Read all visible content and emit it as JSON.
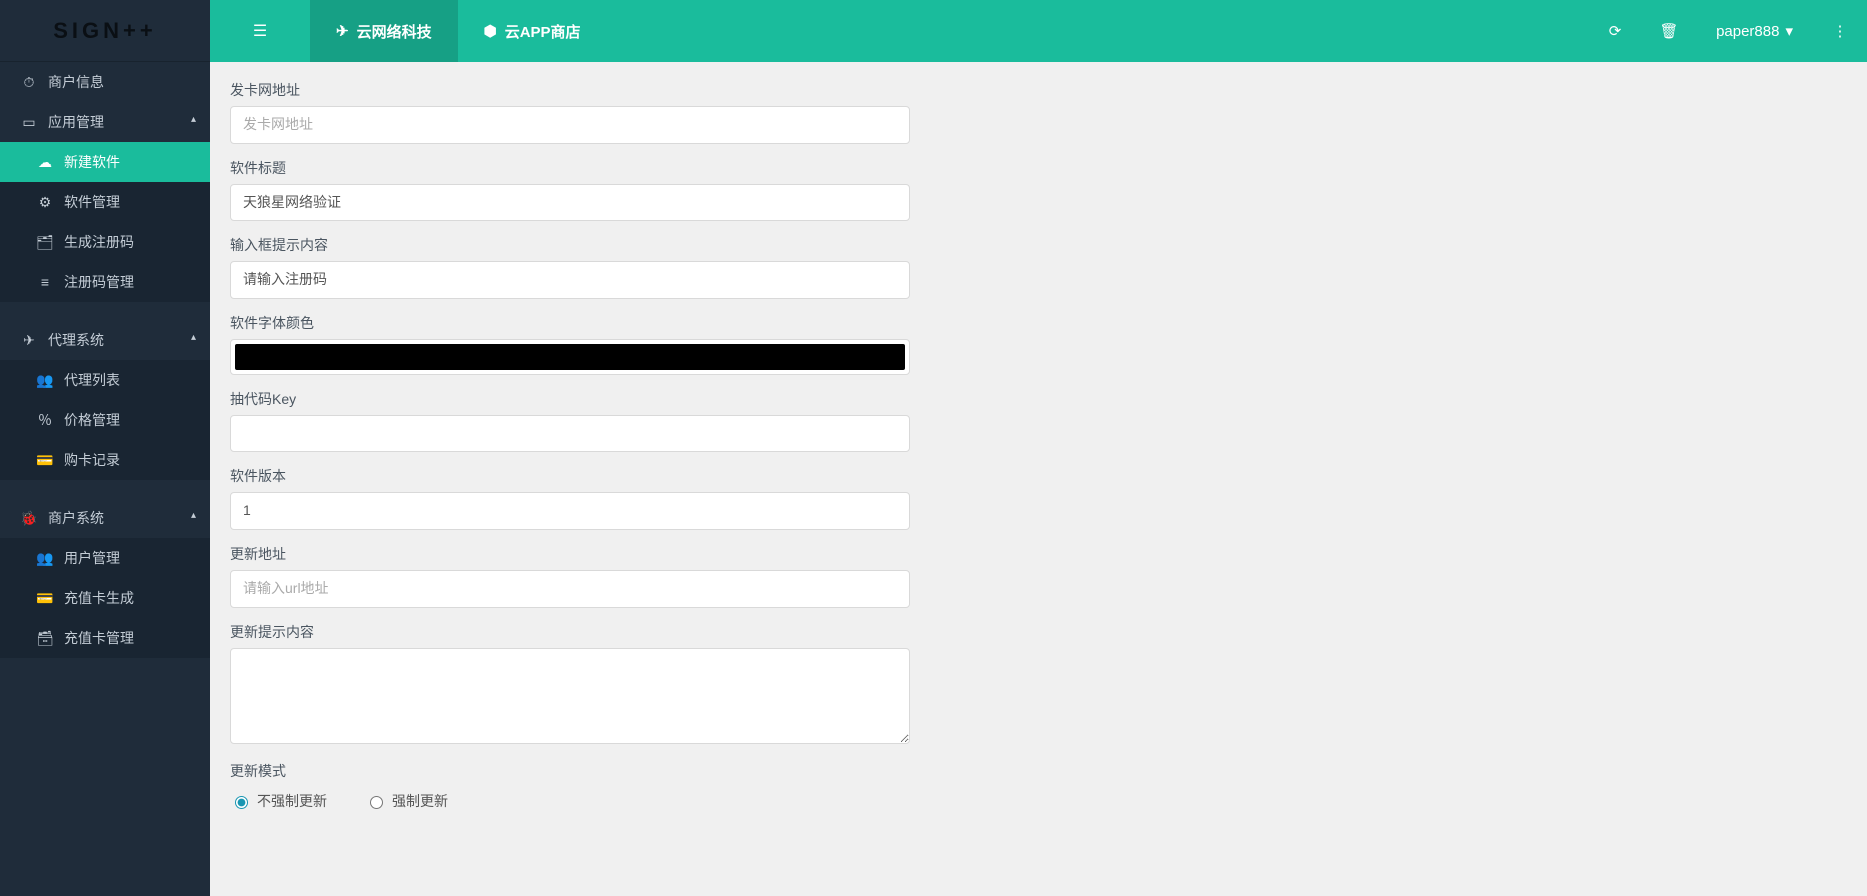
{
  "logo": "SIGN++",
  "topbar": {
    "tabs": [
      {
        "icon": "paper-plane",
        "label": "云网络科技",
        "active": true
      },
      {
        "icon": "dropbox",
        "label": "云APP商店",
        "active": false
      }
    ],
    "username": "paper888"
  },
  "sidebar": {
    "items": [
      {
        "icon": "dashboard",
        "label": "商户信息",
        "type": "item"
      },
      {
        "icon": "window",
        "label": "应用管理",
        "type": "group",
        "expanded": true,
        "children": [
          {
            "icon": "cloud",
            "label": "新建软件",
            "active": true
          },
          {
            "icon": "cogs",
            "label": "软件管理"
          },
          {
            "icon": "id",
            "label": "生成注册码"
          },
          {
            "icon": "list",
            "label": "注册码管理"
          }
        ]
      },
      {
        "icon": "paper-plane",
        "label": "代理系统",
        "type": "group",
        "expanded": true,
        "children": [
          {
            "icon": "users",
            "label": "代理列表"
          },
          {
            "icon": "percent",
            "label": "价格管理"
          },
          {
            "icon": "card",
            "label": "购卡记录"
          }
        ]
      },
      {
        "icon": "bug",
        "label": "商户系统",
        "type": "group",
        "expanded": true,
        "children": [
          {
            "icon": "users",
            "label": "用户管理"
          },
          {
            "icon": "card",
            "label": "充值卡生成"
          },
          {
            "icon": "cards",
            "label": "充值卡管理"
          }
        ]
      }
    ]
  },
  "form": {
    "fields": {
      "card_url": {
        "label": "发卡网地址",
        "placeholder": "发卡网地址",
        "value": ""
      },
      "title": {
        "label": "软件标题",
        "value": "天狼星网络验证"
      },
      "input_hint": {
        "label": "输入框提示内容",
        "value": "请输入注册码"
      },
      "font_color": {
        "label": "软件字体颜色",
        "value": "#000000"
      },
      "extract_key": {
        "label": "抽代码Key",
        "value": ""
      },
      "version": {
        "label": "软件版本",
        "value": "1"
      },
      "update_url": {
        "label": "更新地址",
        "placeholder": "请输入url地址",
        "value": ""
      },
      "update_hint": {
        "label": "更新提示内容",
        "value": ""
      },
      "update_mode": {
        "label": "更新模式",
        "options": [
          "不强制更新",
          "强制更新"
        ],
        "selected": 0
      }
    }
  },
  "icons": {
    "dashboard": "⏱",
    "window": "▭",
    "cloud": "☁",
    "cogs": "⚙",
    "id": "🗂",
    "list": "≡",
    "paper-plane": "✈",
    "users": "👥",
    "percent": "％",
    "card": "💳",
    "cards": "🗃",
    "bug": "🐞",
    "dropbox": "⬢",
    "refresh": "⟳",
    "trash": "🗑",
    "caret": "▾",
    "more": "⋮",
    "indent": "☰"
  }
}
